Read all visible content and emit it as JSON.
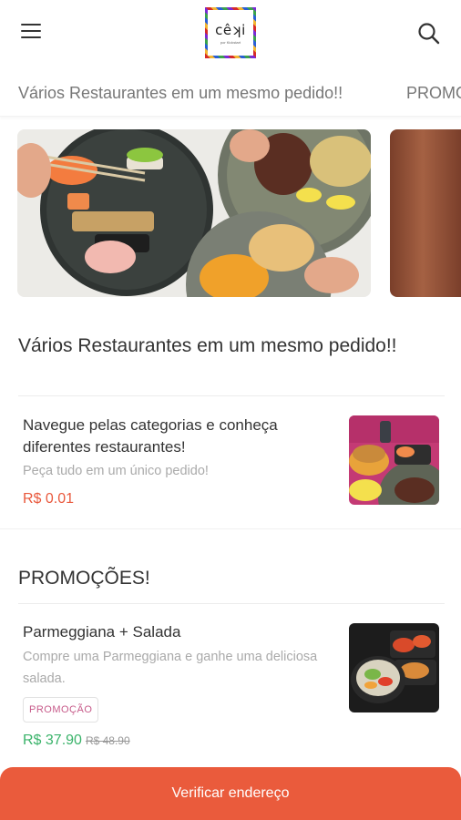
{
  "header": {
    "logo_text": "cêʞi",
    "logo_subtext": "por Kickstart",
    "menu_icon": "hamburger-menu-icon",
    "search_icon": "search-icon"
  },
  "tabs": [
    {
      "label": "Vários Restaurantes em um mesmo pedido!!"
    },
    {
      "label": "PROMOÇÕES!"
    }
  ],
  "sections": [
    {
      "title": "Vários Restaurantes em um mesmo pedido!!",
      "items": [
        {
          "name": "Navegue pelas categorias e conheça diferentes restaurantes!",
          "description": "Peça tudo em um único pedido!",
          "price": "R$ 0.01"
        }
      ]
    },
    {
      "title": "PROMOÇÕES!",
      "items": [
        {
          "name": "Parmeggiana + Salada",
          "description": "Compre uma Parmeggiana e ganhe uma deliciosa salada.",
          "badge": "PROMOÇÃO",
          "price": "R$ 37.90",
          "old_price": "R$ 48.90"
        }
      ]
    }
  ],
  "footer": {
    "cta_label": "Verificar endereço"
  },
  "colors": {
    "accent": "#ea5b3c",
    "price_red": "#e9593d",
    "price_green": "#3ab36a",
    "badge_text": "#c75b8a"
  }
}
